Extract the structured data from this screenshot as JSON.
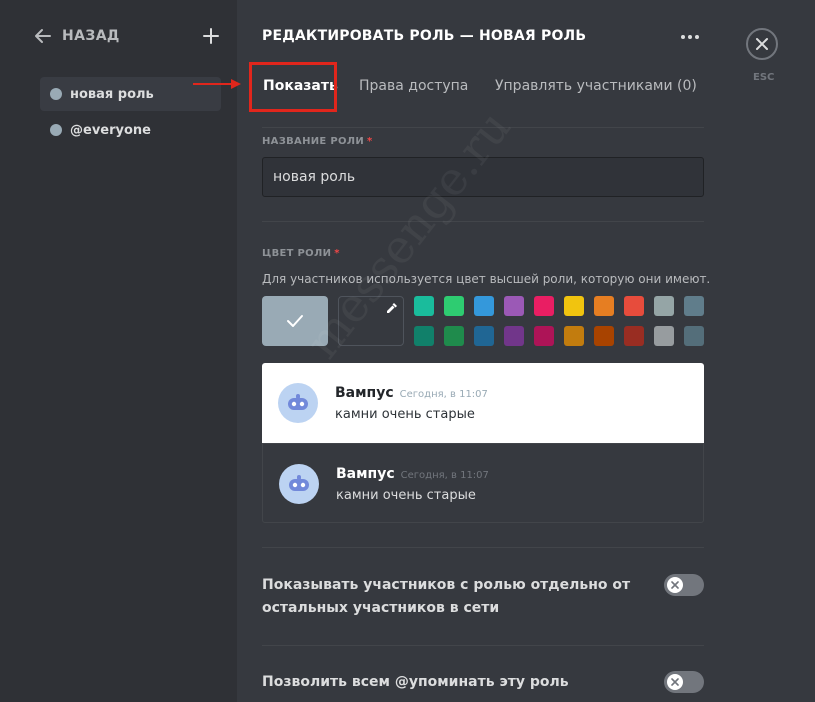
{
  "sidebar": {
    "back_label": "НАЗАД",
    "roles": [
      {
        "label": "новая роль",
        "selected": true
      },
      {
        "label": "@everyone",
        "selected": false
      }
    ]
  },
  "header": {
    "title": "РЕДАКТИРОВАТЬ РОЛЬ — НОВАЯ РОЛЬ",
    "esc_label": "ESC"
  },
  "tabs": [
    {
      "label": "Показать",
      "active": true
    },
    {
      "label": "Права доступа",
      "active": false
    },
    {
      "label": "Управлять участниками (0)",
      "active": false
    }
  ],
  "role_name": {
    "label": "НАЗВАНИЕ РОЛИ",
    "required_mark": "*",
    "value": "новая роль"
  },
  "role_color": {
    "label": "ЦВЕТ РОЛИ",
    "required_mark": "*",
    "description": "Для участников используется цвет высшей роли, которую они имеют.",
    "default_color": "#99aab5",
    "palette_top": [
      "#1abc9c",
      "#2ecc71",
      "#3498db",
      "#9b59b6",
      "#e91e63",
      "#f1c40f",
      "#e67e22",
      "#e74c3c",
      "#95a5a6",
      "#607d8b"
    ],
    "palette_bottom": [
      "#11806a",
      "#1f8b4c",
      "#206694",
      "#71368a",
      "#ad1457",
      "#c27c0e",
      "#a84300",
      "#992d22",
      "#979c9f",
      "#546e7a"
    ]
  },
  "preview": {
    "author": "Вампус",
    "time": "Сегодня, в 11:07",
    "text": "камни очень старые"
  },
  "settings": [
    {
      "label": "Показывать участников с ролью отдельно от остальных участников в сети",
      "enabled": false
    },
    {
      "label": "Позволить всем @упоминать эту роль",
      "enabled": false
    }
  ],
  "watermark": "messenge.ru",
  "colors": {
    "highlight": "#e1261c",
    "background": "#36393f",
    "sidebar": "#2f3136"
  }
}
